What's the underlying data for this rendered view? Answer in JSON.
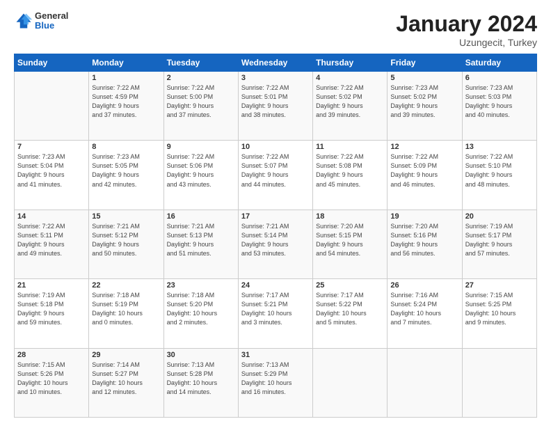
{
  "header": {
    "logo_general": "General",
    "logo_blue": "Blue",
    "title": "January 2024",
    "location": "Uzungecit, Turkey"
  },
  "days_of_week": [
    "Sunday",
    "Monday",
    "Tuesday",
    "Wednesday",
    "Thursday",
    "Friday",
    "Saturday"
  ],
  "weeks": [
    [
      {
        "day": "",
        "info": ""
      },
      {
        "day": "1",
        "info": "Sunrise: 7:22 AM\nSunset: 4:59 PM\nDaylight: 9 hours\nand 37 minutes."
      },
      {
        "day": "2",
        "info": "Sunrise: 7:22 AM\nSunset: 5:00 PM\nDaylight: 9 hours\nand 37 minutes."
      },
      {
        "day": "3",
        "info": "Sunrise: 7:22 AM\nSunset: 5:01 PM\nDaylight: 9 hours\nand 38 minutes."
      },
      {
        "day": "4",
        "info": "Sunrise: 7:22 AM\nSunset: 5:02 PM\nDaylight: 9 hours\nand 39 minutes."
      },
      {
        "day": "5",
        "info": "Sunrise: 7:23 AM\nSunset: 5:02 PM\nDaylight: 9 hours\nand 39 minutes."
      },
      {
        "day": "6",
        "info": "Sunrise: 7:23 AM\nSunset: 5:03 PM\nDaylight: 9 hours\nand 40 minutes."
      }
    ],
    [
      {
        "day": "7",
        "info": "Sunrise: 7:23 AM\nSunset: 5:04 PM\nDaylight: 9 hours\nand 41 minutes."
      },
      {
        "day": "8",
        "info": "Sunrise: 7:23 AM\nSunset: 5:05 PM\nDaylight: 9 hours\nand 42 minutes."
      },
      {
        "day": "9",
        "info": "Sunrise: 7:22 AM\nSunset: 5:06 PM\nDaylight: 9 hours\nand 43 minutes."
      },
      {
        "day": "10",
        "info": "Sunrise: 7:22 AM\nSunset: 5:07 PM\nDaylight: 9 hours\nand 44 minutes."
      },
      {
        "day": "11",
        "info": "Sunrise: 7:22 AM\nSunset: 5:08 PM\nDaylight: 9 hours\nand 45 minutes."
      },
      {
        "day": "12",
        "info": "Sunrise: 7:22 AM\nSunset: 5:09 PM\nDaylight: 9 hours\nand 46 minutes."
      },
      {
        "day": "13",
        "info": "Sunrise: 7:22 AM\nSunset: 5:10 PM\nDaylight: 9 hours\nand 48 minutes."
      }
    ],
    [
      {
        "day": "14",
        "info": "Sunrise: 7:22 AM\nSunset: 5:11 PM\nDaylight: 9 hours\nand 49 minutes."
      },
      {
        "day": "15",
        "info": "Sunrise: 7:21 AM\nSunset: 5:12 PM\nDaylight: 9 hours\nand 50 minutes."
      },
      {
        "day": "16",
        "info": "Sunrise: 7:21 AM\nSunset: 5:13 PM\nDaylight: 9 hours\nand 51 minutes."
      },
      {
        "day": "17",
        "info": "Sunrise: 7:21 AM\nSunset: 5:14 PM\nDaylight: 9 hours\nand 53 minutes."
      },
      {
        "day": "18",
        "info": "Sunrise: 7:20 AM\nSunset: 5:15 PM\nDaylight: 9 hours\nand 54 minutes."
      },
      {
        "day": "19",
        "info": "Sunrise: 7:20 AM\nSunset: 5:16 PM\nDaylight: 9 hours\nand 56 minutes."
      },
      {
        "day": "20",
        "info": "Sunrise: 7:19 AM\nSunset: 5:17 PM\nDaylight: 9 hours\nand 57 minutes."
      }
    ],
    [
      {
        "day": "21",
        "info": "Sunrise: 7:19 AM\nSunset: 5:18 PM\nDaylight: 9 hours\nand 59 minutes."
      },
      {
        "day": "22",
        "info": "Sunrise: 7:18 AM\nSunset: 5:19 PM\nDaylight: 10 hours\nand 0 minutes."
      },
      {
        "day": "23",
        "info": "Sunrise: 7:18 AM\nSunset: 5:20 PM\nDaylight: 10 hours\nand 2 minutes."
      },
      {
        "day": "24",
        "info": "Sunrise: 7:17 AM\nSunset: 5:21 PM\nDaylight: 10 hours\nand 3 minutes."
      },
      {
        "day": "25",
        "info": "Sunrise: 7:17 AM\nSunset: 5:22 PM\nDaylight: 10 hours\nand 5 minutes."
      },
      {
        "day": "26",
        "info": "Sunrise: 7:16 AM\nSunset: 5:24 PM\nDaylight: 10 hours\nand 7 minutes."
      },
      {
        "day": "27",
        "info": "Sunrise: 7:15 AM\nSunset: 5:25 PM\nDaylight: 10 hours\nand 9 minutes."
      }
    ],
    [
      {
        "day": "28",
        "info": "Sunrise: 7:15 AM\nSunset: 5:26 PM\nDaylight: 10 hours\nand 10 minutes."
      },
      {
        "day": "29",
        "info": "Sunrise: 7:14 AM\nSunset: 5:27 PM\nDaylight: 10 hours\nand 12 minutes."
      },
      {
        "day": "30",
        "info": "Sunrise: 7:13 AM\nSunset: 5:28 PM\nDaylight: 10 hours\nand 14 minutes."
      },
      {
        "day": "31",
        "info": "Sunrise: 7:13 AM\nSunset: 5:29 PM\nDaylight: 10 hours\nand 16 minutes."
      },
      {
        "day": "",
        "info": ""
      },
      {
        "day": "",
        "info": ""
      },
      {
        "day": "",
        "info": ""
      }
    ]
  ]
}
